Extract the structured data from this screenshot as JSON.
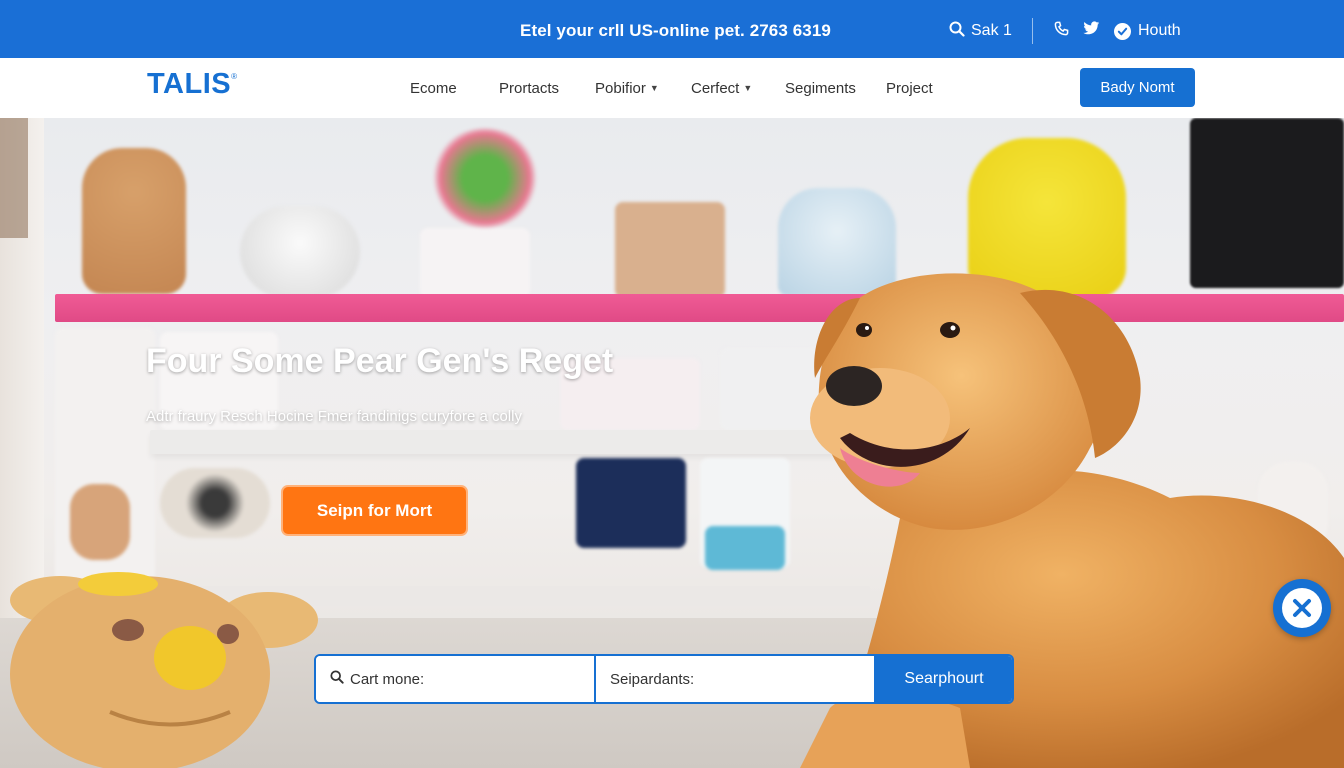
{
  "topbar": {
    "promo_text": "Etel your crll US-online pet. 2763 6319",
    "search_label": "Sak 1",
    "account_label": "Houth",
    "icons": [
      "search-icon",
      "phone-icon",
      "twitter-icon",
      "user-circle-icon"
    ]
  },
  "navbar": {
    "logo": "TALIS",
    "logo_mark": "®",
    "items": [
      {
        "label": "Ecome",
        "dropdown": false
      },
      {
        "label": "Prortacts",
        "dropdown": false
      },
      {
        "label": "Pobifior",
        "dropdown": true
      },
      {
        "label": "Cerfect",
        "dropdown": true
      },
      {
        "label": "Segiments",
        "dropdown": false
      },
      {
        "label": "Project",
        "dropdown": false
      }
    ],
    "cta_label": "Bady Nomt"
  },
  "hero": {
    "title": "Four Some Pear Gen's Reget",
    "subtitle": "Adtr fraury Resch Hocine Fmer fandinigs curyfore a colly",
    "cta_label": "Seipn for Mort"
  },
  "search": {
    "field1_placeholder": "Cart mone:",
    "field2_placeholder": "Seipardants:",
    "button_label": "Searphourt"
  },
  "colors": {
    "brand_blue": "#1670d2",
    "topbar_blue": "#1a6fd6",
    "cta_orange": "#ff7512",
    "shelf_pink": "#e04a86"
  }
}
